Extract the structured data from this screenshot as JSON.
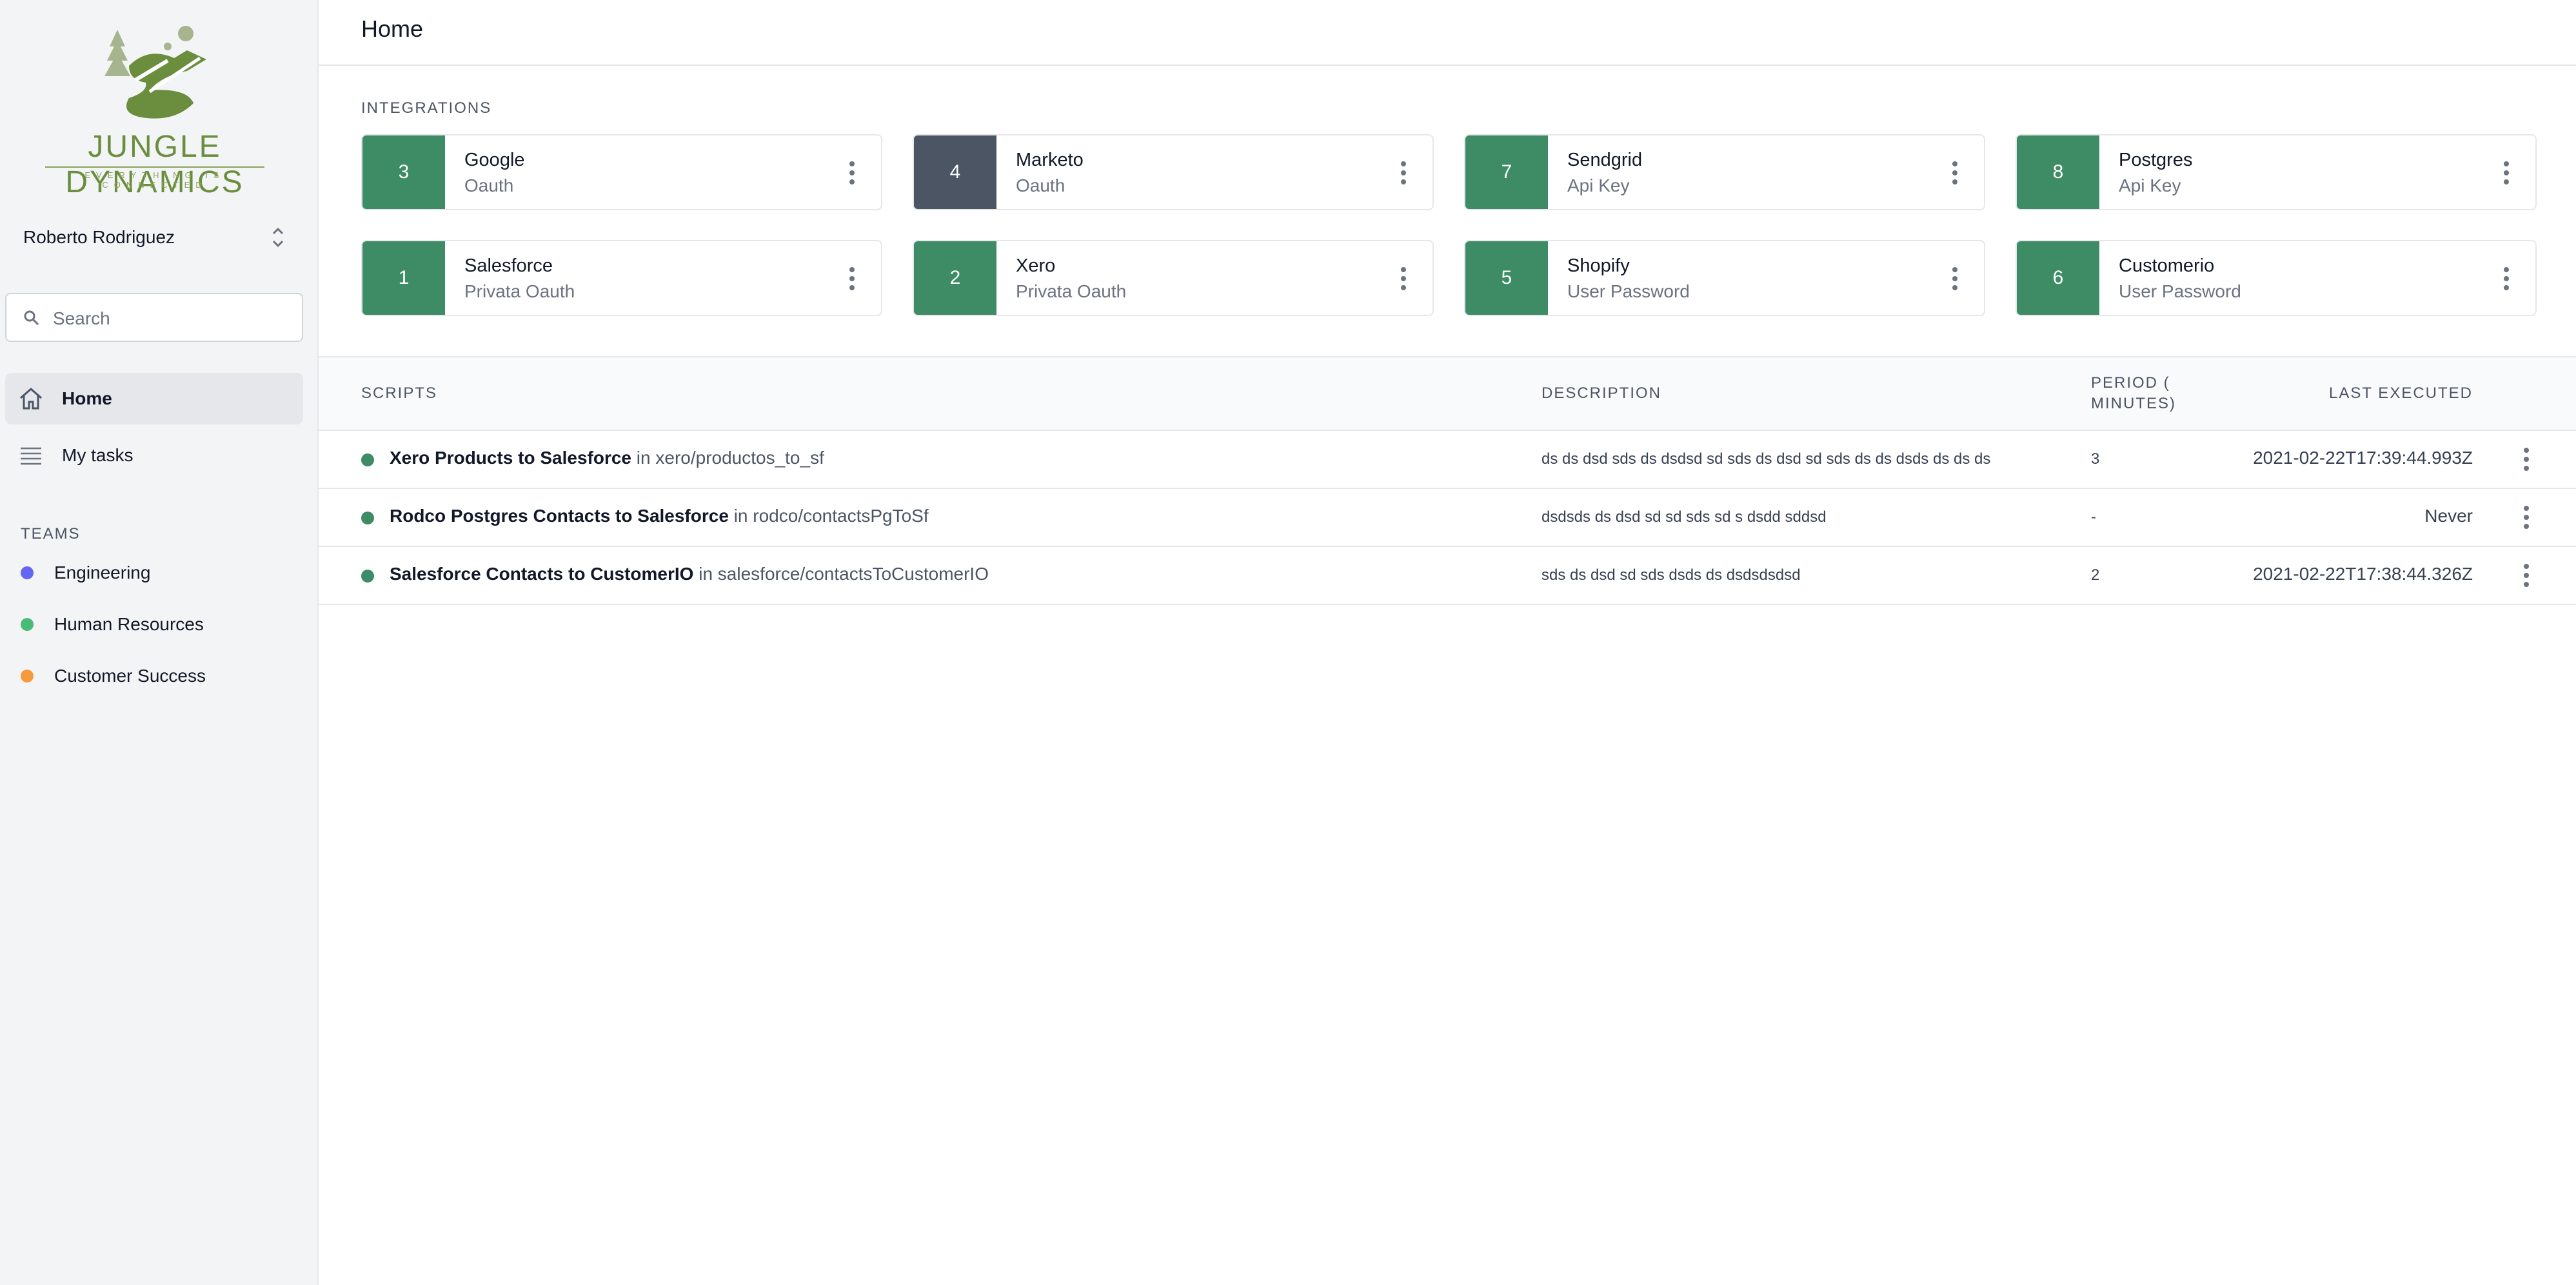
{
  "brand": {
    "name": "JUNGLE DYNAMICS",
    "tagline": "EVERYTHING IS CONNECTED",
    "color": "#6b8e3e"
  },
  "sidebar": {
    "user_name": "Roberto Rodriguez",
    "search_placeholder": "Search",
    "nav": [
      {
        "label": "Home",
        "icon": "home-icon",
        "active": true
      },
      {
        "label": "My tasks",
        "icon": "list-icon",
        "active": false
      }
    ],
    "teams_title": "TEAMS",
    "teams": [
      {
        "label": "Engineering",
        "color": "#6366f1"
      },
      {
        "label": "Human Resources",
        "color": "#48bb78"
      },
      {
        "label": "Customer Success",
        "color": "#f6993f"
      }
    ]
  },
  "page": {
    "title": "Home"
  },
  "integrations": {
    "label": "INTEGRATIONS",
    "items": [
      {
        "num": "3",
        "name": "Google",
        "type": "Oauth",
        "color": "#3d8c65"
      },
      {
        "num": "4",
        "name": "Marketo",
        "type": "Oauth",
        "color": "#4b5563"
      },
      {
        "num": "7",
        "name": "Sendgrid",
        "type": "Api Key",
        "color": "#3d8c65"
      },
      {
        "num": "8",
        "name": "Postgres",
        "type": "Api Key",
        "color": "#3d8c65"
      },
      {
        "num": "1",
        "name": "Salesforce",
        "type": "Privata Oauth",
        "color": "#3d8c65"
      },
      {
        "num": "2",
        "name": "Xero",
        "type": "Privata Oauth",
        "color": "#3d8c65"
      },
      {
        "num": "5",
        "name": "Shopify",
        "type": "User Password",
        "color": "#3d8c65"
      },
      {
        "num": "6",
        "name": "Customerio",
        "type": "User Password",
        "color": "#3d8c65"
      }
    ]
  },
  "scripts": {
    "headers": {
      "scripts": "SCRIPTS",
      "description": "DESCRIPTION",
      "period": "PERIOD ( MINUTES)",
      "last_executed": "LAST EXECUTED"
    },
    "rows": [
      {
        "name": "Xero Products to Salesforce",
        "path": "in xero/productos_to_sf",
        "description": "ds ds dsd sds ds dsdsd sd sds ds dsd sd sds ds ds dsds ds ds ds",
        "period": "3",
        "last_executed": "2021-02-22T17:39:44.993Z",
        "status_color": "#3d8c65"
      },
      {
        "name": "Rodco Postgres Contacts to Salesforce",
        "path": "in rodco/contactsPgToSf",
        "description": "dsdsds ds dsd sd sd sds sd s dsdd sddsd",
        "period": "-",
        "last_executed": "Never",
        "status_color": "#3d8c65"
      },
      {
        "name": "Salesforce Contacts to CustomerIO",
        "path": "in salesforce/contactsToCustomerIO",
        "description": "sds ds dsd sd sds dsds ds dsdsdsdsd",
        "period": "2",
        "last_executed": "2021-02-22T17:38:44.326Z",
        "status_color": "#3d8c65"
      }
    ]
  }
}
